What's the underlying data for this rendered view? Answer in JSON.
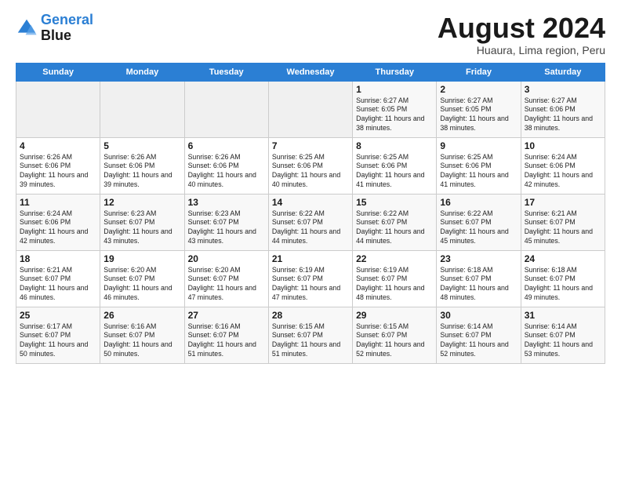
{
  "header": {
    "logo_line1": "General",
    "logo_line2": "Blue",
    "month_year": "August 2024",
    "location": "Huaura, Lima region, Peru"
  },
  "days_of_week": [
    "Sunday",
    "Monday",
    "Tuesday",
    "Wednesday",
    "Thursday",
    "Friday",
    "Saturday"
  ],
  "weeks": [
    [
      {
        "day": "",
        "sunrise": "",
        "sunset": "",
        "daylight": ""
      },
      {
        "day": "",
        "sunrise": "",
        "sunset": "",
        "daylight": ""
      },
      {
        "day": "",
        "sunrise": "",
        "sunset": "",
        "daylight": ""
      },
      {
        "day": "",
        "sunrise": "",
        "sunset": "",
        "daylight": ""
      },
      {
        "day": "1",
        "sunrise": "Sunrise: 6:27 AM",
        "sunset": "Sunset: 6:05 PM",
        "daylight": "Daylight: 11 hours and 38 minutes."
      },
      {
        "day": "2",
        "sunrise": "Sunrise: 6:27 AM",
        "sunset": "Sunset: 6:05 PM",
        "daylight": "Daylight: 11 hours and 38 minutes."
      },
      {
        "day": "3",
        "sunrise": "Sunrise: 6:27 AM",
        "sunset": "Sunset: 6:06 PM",
        "daylight": "Daylight: 11 hours and 38 minutes."
      }
    ],
    [
      {
        "day": "4",
        "sunrise": "Sunrise: 6:26 AM",
        "sunset": "Sunset: 6:06 PM",
        "daylight": "Daylight: 11 hours and 39 minutes."
      },
      {
        "day": "5",
        "sunrise": "Sunrise: 6:26 AM",
        "sunset": "Sunset: 6:06 PM",
        "daylight": "Daylight: 11 hours and 39 minutes."
      },
      {
        "day": "6",
        "sunrise": "Sunrise: 6:26 AM",
        "sunset": "Sunset: 6:06 PM",
        "daylight": "Daylight: 11 hours and 40 minutes."
      },
      {
        "day": "7",
        "sunrise": "Sunrise: 6:25 AM",
        "sunset": "Sunset: 6:06 PM",
        "daylight": "Daylight: 11 hours and 40 minutes."
      },
      {
        "day": "8",
        "sunrise": "Sunrise: 6:25 AM",
        "sunset": "Sunset: 6:06 PM",
        "daylight": "Daylight: 11 hours and 41 minutes."
      },
      {
        "day": "9",
        "sunrise": "Sunrise: 6:25 AM",
        "sunset": "Sunset: 6:06 PM",
        "daylight": "Daylight: 11 hours and 41 minutes."
      },
      {
        "day": "10",
        "sunrise": "Sunrise: 6:24 AM",
        "sunset": "Sunset: 6:06 PM",
        "daylight": "Daylight: 11 hours and 42 minutes."
      }
    ],
    [
      {
        "day": "11",
        "sunrise": "Sunrise: 6:24 AM",
        "sunset": "Sunset: 6:06 PM",
        "daylight": "Daylight: 11 hours and 42 minutes."
      },
      {
        "day": "12",
        "sunrise": "Sunrise: 6:23 AM",
        "sunset": "Sunset: 6:07 PM",
        "daylight": "Daylight: 11 hours and 43 minutes."
      },
      {
        "day": "13",
        "sunrise": "Sunrise: 6:23 AM",
        "sunset": "Sunset: 6:07 PM",
        "daylight": "Daylight: 11 hours and 43 minutes."
      },
      {
        "day": "14",
        "sunrise": "Sunrise: 6:22 AM",
        "sunset": "Sunset: 6:07 PM",
        "daylight": "Daylight: 11 hours and 44 minutes."
      },
      {
        "day": "15",
        "sunrise": "Sunrise: 6:22 AM",
        "sunset": "Sunset: 6:07 PM",
        "daylight": "Daylight: 11 hours and 44 minutes."
      },
      {
        "day": "16",
        "sunrise": "Sunrise: 6:22 AM",
        "sunset": "Sunset: 6:07 PM",
        "daylight": "Daylight: 11 hours and 45 minutes."
      },
      {
        "day": "17",
        "sunrise": "Sunrise: 6:21 AM",
        "sunset": "Sunset: 6:07 PM",
        "daylight": "Daylight: 11 hours and 45 minutes."
      }
    ],
    [
      {
        "day": "18",
        "sunrise": "Sunrise: 6:21 AM",
        "sunset": "Sunset: 6:07 PM",
        "daylight": "Daylight: 11 hours and 46 minutes."
      },
      {
        "day": "19",
        "sunrise": "Sunrise: 6:20 AM",
        "sunset": "Sunset: 6:07 PM",
        "daylight": "Daylight: 11 hours and 46 minutes."
      },
      {
        "day": "20",
        "sunrise": "Sunrise: 6:20 AM",
        "sunset": "Sunset: 6:07 PM",
        "daylight": "Daylight: 11 hours and 47 minutes."
      },
      {
        "day": "21",
        "sunrise": "Sunrise: 6:19 AM",
        "sunset": "Sunset: 6:07 PM",
        "daylight": "Daylight: 11 hours and 47 minutes."
      },
      {
        "day": "22",
        "sunrise": "Sunrise: 6:19 AM",
        "sunset": "Sunset: 6:07 PM",
        "daylight": "Daylight: 11 hours and 48 minutes."
      },
      {
        "day": "23",
        "sunrise": "Sunrise: 6:18 AM",
        "sunset": "Sunset: 6:07 PM",
        "daylight": "Daylight: 11 hours and 48 minutes."
      },
      {
        "day": "24",
        "sunrise": "Sunrise: 6:18 AM",
        "sunset": "Sunset: 6:07 PM",
        "daylight": "Daylight: 11 hours and 49 minutes."
      }
    ],
    [
      {
        "day": "25",
        "sunrise": "Sunrise: 6:17 AM",
        "sunset": "Sunset: 6:07 PM",
        "daylight": "Daylight: 11 hours and 50 minutes."
      },
      {
        "day": "26",
        "sunrise": "Sunrise: 6:16 AM",
        "sunset": "Sunset: 6:07 PM",
        "daylight": "Daylight: 11 hours and 50 minutes."
      },
      {
        "day": "27",
        "sunrise": "Sunrise: 6:16 AM",
        "sunset": "Sunset: 6:07 PM",
        "daylight": "Daylight: 11 hours and 51 minutes."
      },
      {
        "day": "28",
        "sunrise": "Sunrise: 6:15 AM",
        "sunset": "Sunset: 6:07 PM",
        "daylight": "Daylight: 11 hours and 51 minutes."
      },
      {
        "day": "29",
        "sunrise": "Sunrise: 6:15 AM",
        "sunset": "Sunset: 6:07 PM",
        "daylight": "Daylight: 11 hours and 52 minutes."
      },
      {
        "day": "30",
        "sunrise": "Sunrise: 6:14 AM",
        "sunset": "Sunset: 6:07 PM",
        "daylight": "Daylight: 11 hours and 52 minutes."
      },
      {
        "day": "31",
        "sunrise": "Sunrise: 6:14 AM",
        "sunset": "Sunset: 6:07 PM",
        "daylight": "Daylight: 11 hours and 53 minutes."
      }
    ]
  ]
}
